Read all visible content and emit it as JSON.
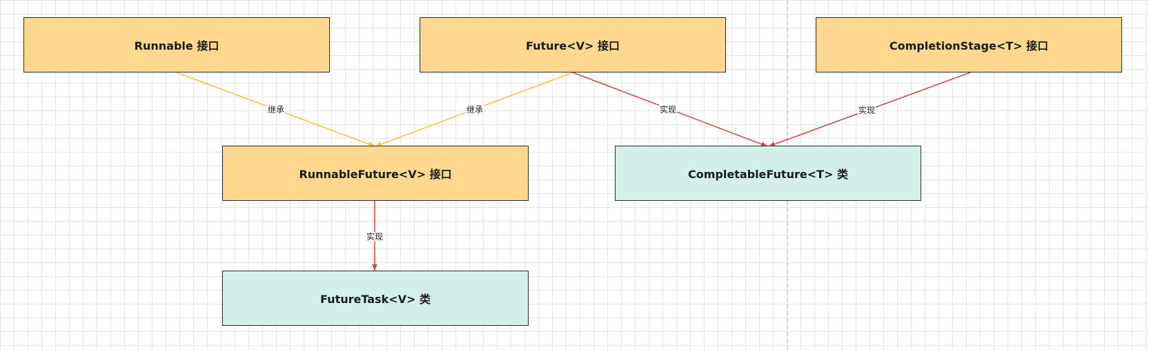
{
  "nodes": {
    "runnable": {
      "label": "Runnable 接口",
      "kind": "interface"
    },
    "future": {
      "label": "Future<V> 接口",
      "kind": "interface"
    },
    "completion_stage": {
      "label": "CompletionStage<T> 接口",
      "kind": "interface"
    },
    "runnable_future": {
      "label": "RunnableFuture<V> 接口",
      "kind": "interface"
    },
    "completable_future": {
      "label": "CompletableFuture<T> 类",
      "kind": "class"
    },
    "future_task": {
      "label": "FutureTask<V> 类",
      "kind": "class"
    }
  },
  "edges": {
    "runnable_to_runnable_future": {
      "label": "继承",
      "relation": "extends"
    },
    "future_to_runnable_future": {
      "label": "继承",
      "relation": "extends"
    },
    "future_to_completable_future": {
      "label": "实现",
      "relation": "implements"
    },
    "completion_stage_to_completable_future": {
      "label": "实现",
      "relation": "implements"
    },
    "runnable_future_to_future_task": {
      "label": "实现",
      "relation": "implements"
    }
  },
  "colors": {
    "interface_fill": "#ffd78e",
    "class_fill": "#d2efea",
    "extends_edge": "#f5c342",
    "implements_edge": "#c0504d"
  }
}
